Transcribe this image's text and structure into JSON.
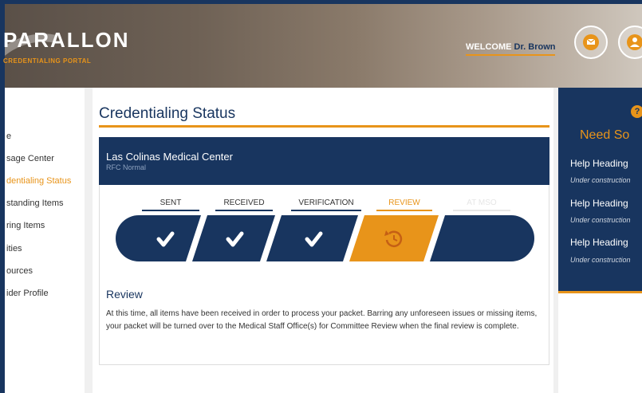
{
  "header": {
    "logo": "PARALLON",
    "logo_sub": "CREDENTIALING PORTAL",
    "welcome_label": "WELCOME",
    "user_name": "Dr. Brown"
  },
  "sidebar": {
    "items": [
      {
        "label": "e",
        "active": false
      },
      {
        "label": "sage Center",
        "active": false
      },
      {
        "label": "dentialing Status",
        "active": true
      },
      {
        "label": "standing Items",
        "active": false
      },
      {
        "label": "ring Items",
        "active": false
      },
      {
        "label": "ities",
        "active": false
      },
      {
        "label": "ources",
        "active": false
      },
      {
        "label": "ider Profile",
        "active": false
      }
    ]
  },
  "main": {
    "title": "Credentialing Status",
    "facility": {
      "name": "Las Colinas Medical Center",
      "subtitle": "RFC Normal"
    },
    "steps": [
      {
        "label": "SENT",
        "status": "complete"
      },
      {
        "label": "RECEIVED",
        "status": "complete"
      },
      {
        "label": "VERIFICATION",
        "status": "complete"
      },
      {
        "label": "REVIEW",
        "status": "current"
      },
      {
        "label": "AT MSO",
        "status": "pending"
      }
    ],
    "review": {
      "heading": "Review",
      "text": "At this time, all items have been received in order to process your packet. Barring any unforeseen issues or missing items, your packet will be turned over to the Medical Staff Office(s) for Committee Review when the final review is complete."
    }
  },
  "help": {
    "icon_text": "?",
    "title": "Need So",
    "items": [
      {
        "heading": "Help Heading",
        "sub": "Under construction"
      },
      {
        "heading": "Help Heading",
        "sub": "Under construction"
      },
      {
        "heading": "Help Heading",
        "sub": "Under construction"
      }
    ]
  },
  "colors": {
    "navy": "#18355f",
    "orange": "#e8941a"
  }
}
